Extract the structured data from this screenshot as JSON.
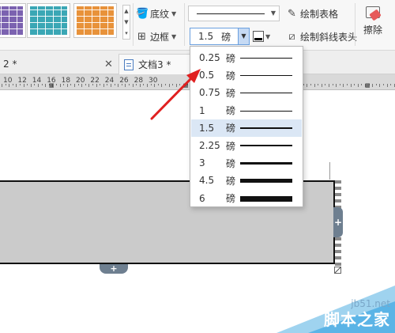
{
  "ribbon": {
    "shading_label": "底纹",
    "borders_label": "边框",
    "draw_table_label": "绘制表格",
    "draw_diagonal_label": "绘制斜线表头",
    "eraser_label": "擦除",
    "line_weight": {
      "value": "1.5",
      "unit": "磅"
    },
    "table_style_colors": [
      "#7b62b0",
      "#3aa7b5",
      "#e8923a"
    ]
  },
  "tabs": [
    {
      "label": "2 *"
    },
    {
      "label": "文档3 *"
    }
  ],
  "ruler": {
    "numbers": [
      "10",
      "12",
      "14",
      "16",
      "18",
      "20",
      "22",
      "24",
      "26",
      "28",
      "30"
    ]
  },
  "line_weight_menu": {
    "selected": "1.5",
    "options": [
      {
        "value": "0.25",
        "unit": "磅"
      },
      {
        "value": "0.5",
        "unit": "磅"
      },
      {
        "value": "0.75",
        "unit": "磅"
      },
      {
        "value": "1",
        "unit": "磅"
      },
      {
        "value": "1.5",
        "unit": "磅"
      },
      {
        "value": "2.25",
        "unit": "磅"
      },
      {
        "value": "3",
        "unit": "磅"
      },
      {
        "value": "4.5",
        "unit": "磅"
      },
      {
        "value": "6",
        "unit": "磅"
      }
    ]
  },
  "table": {
    "add_column_symbol": "+",
    "add_row_symbol": "+"
  },
  "watermark": {
    "site": "jb51.net",
    "name": "脚本之家"
  },
  "colors": {
    "accent": "#6ba0e0",
    "selected_bg": "#dbe7f5",
    "arrow": "#e02020"
  }
}
